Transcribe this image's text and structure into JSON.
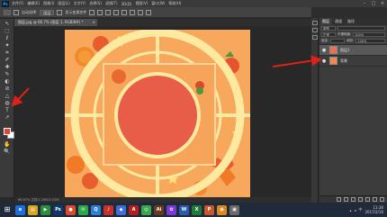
{
  "app": {
    "logo_text": "Ps"
  },
  "menu": [
    "文件(F)",
    "编辑(E)",
    "图像(I)",
    "图层(L)",
    "文字(Y)",
    "选择(S)",
    "滤镜(T)",
    "3D(D)",
    "视图(V)",
    "窗口(W)",
    "帮助(H)"
  ],
  "window_controls": [
    "–",
    "□",
    "×"
  ],
  "options_bar": {
    "preset_label": "自动选择:",
    "preset_value": "图层",
    "transform_label": "显示变换控件"
  },
  "document_tab": {
    "title": "图层.jpg @ 66.7% (图层 1, RGB/8#) *",
    "close": "×"
  },
  "status_bar": {
    "text": "66.67%   文档:1.26M/2.52M"
  },
  "tools": [
    "↖",
    "⬚",
    "ℓ",
    "✦",
    "⌗",
    "✐",
    "✚",
    "✎",
    "◐",
    "⊘",
    "△",
    "◍",
    "T",
    "↗",
    "▭",
    "✋",
    "🔍"
  ],
  "colors": {
    "foreground": "#e0433a",
    "background": "#ffffff",
    "canvas_bg": "#f6a45a",
    "accent_red": "#e0433a"
  },
  "layers_panel": {
    "tabs": [
      "图层",
      "通道",
      "路径"
    ],
    "kind_label": "类型",
    "blend_mode": "正常",
    "opacity_label": "不透明度:",
    "opacity_value": "100%",
    "lock_label": "锁定:",
    "fill_label": "填充:",
    "fill_value": "100%",
    "layers": [
      {
        "name": "图层1",
        "selected": true
      },
      {
        "name": "背景",
        "selected": false
      }
    ]
  },
  "taskbar": {
    "icons": [
      {
        "name": "ie",
        "glyph": "e",
        "color": "#1e6fd9"
      },
      {
        "name": "explorer",
        "glyph": "▤",
        "color": "#d9a41e"
      },
      {
        "name": "media",
        "glyph": "▶",
        "color": "#2a8f3a"
      },
      {
        "name": "photoshop",
        "glyph": "Ps",
        "color": "#0d3a66"
      },
      {
        "name": "chrome",
        "glyph": "●",
        "color": "#d94b2a"
      },
      {
        "name": "wechat",
        "glyph": "✉",
        "color": "#2aa84a"
      },
      {
        "name": "qq",
        "glyph": "Q",
        "color": "#2a7fd9"
      },
      {
        "name": "app-red",
        "glyph": "♪",
        "color": "#c9302c"
      },
      {
        "name": "app-blue",
        "glyph": "◆",
        "color": "#3a6fd9"
      },
      {
        "name": "acrobat",
        "glyph": "A",
        "color": "#b31e1e"
      },
      {
        "name": "app-green",
        "glyph": "◎",
        "color": "#3aa84a"
      },
      {
        "name": "illustrator",
        "glyph": "Ai",
        "color": "#6a3a1e"
      },
      {
        "name": "app-purple",
        "glyph": "✿",
        "color": "#7a3ad9"
      },
      {
        "name": "word",
        "glyph": "W",
        "color": "#2a5ab3"
      },
      {
        "name": "excel",
        "glyph": "X",
        "color": "#1e7a3a"
      },
      {
        "name": "powerpoint",
        "glyph": "P",
        "color": "#c9572c"
      },
      {
        "name": "app-orange",
        "glyph": "◉",
        "color": "#d98a1e"
      },
      {
        "name": "app-gray",
        "glyph": "▣",
        "color": "#6a6a6a"
      }
    ],
    "clock_time": "11:36",
    "clock_date": "2017/2/16",
    "ime": "中"
  }
}
